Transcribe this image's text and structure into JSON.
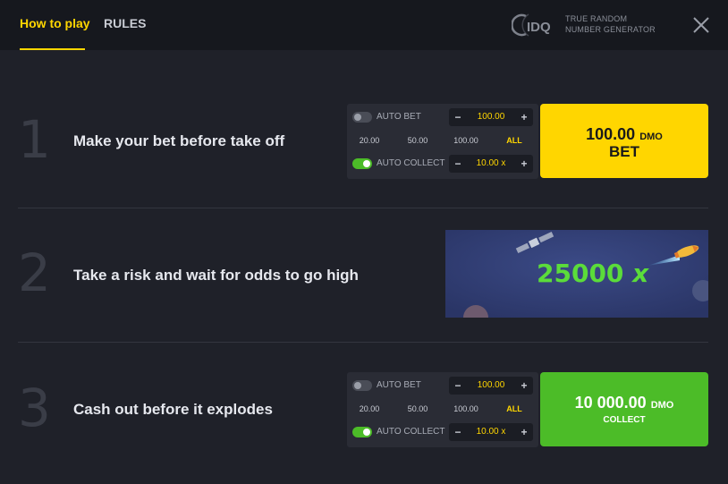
{
  "header": {
    "tabs": [
      {
        "label": "How to play",
        "active": true
      },
      {
        "label": "RULES",
        "active": false
      }
    ],
    "rng": {
      "line1": "TRUE RANDOM",
      "line2": "NUMBER GENERATOR"
    },
    "close_icon": "close-icon"
  },
  "steps": [
    {
      "number": "1",
      "text": "Make your bet before take off",
      "panel": {
        "auto_bet_label": "AUTO BET",
        "auto_bet_on": false,
        "bet_value": "100.00",
        "quick": [
          "20.00",
          "50.00",
          "100.00",
          "ALL"
        ],
        "auto_collect_label": "AUTO COLLECT",
        "auto_collect_on": true,
        "collect_value": "10.00 x"
      },
      "button": {
        "amount": "100.00",
        "currency": "DMO",
        "label": "BET"
      }
    },
    {
      "number": "2",
      "text": "Take a risk and wait for odds to go high",
      "multiplier": {
        "value": "25000",
        "suffix": "x"
      }
    },
    {
      "number": "3",
      "text": "Cash out before it explodes",
      "panel": {
        "auto_bet_label": "AUTO BET",
        "auto_bet_on": false,
        "bet_value": "100.00",
        "quick": [
          "20.00",
          "50.00",
          "100.00",
          "ALL"
        ],
        "auto_collect_label": "AUTO COLLECT",
        "auto_collect_on": true,
        "collect_value": "10.00 x"
      },
      "button": {
        "amount": "10 000.00",
        "currency": "DMO",
        "label": "COLLECT"
      }
    }
  ],
  "colors": {
    "accent": "#ffd600",
    "success": "#4cbc28",
    "background": "#1f2129",
    "header": "#16181e"
  }
}
